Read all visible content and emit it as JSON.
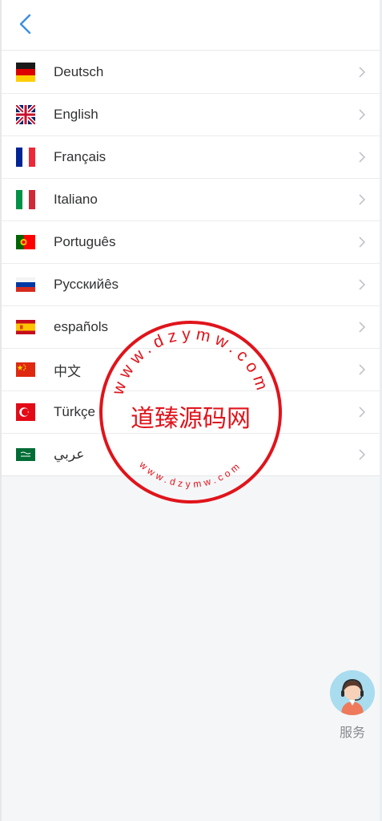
{
  "header": {
    "back_icon": "chevron-left-icon"
  },
  "languages": [
    {
      "label": "Deutsch",
      "flag": "flag-germany-icon"
    },
    {
      "label": "English",
      "flag": "flag-uk-icon"
    },
    {
      "label": "Français",
      "flag": "flag-france-icon"
    },
    {
      "label": "Italiano",
      "flag": "flag-italy-icon"
    },
    {
      "label": "Português",
      "flag": "flag-portugal-icon"
    },
    {
      "label": "Pусскийês",
      "flag": "flag-russia-icon"
    },
    {
      "label": "españols",
      "flag": "flag-spain-icon"
    },
    {
      "label": "中文",
      "flag": "flag-china-icon"
    },
    {
      "label": "Türkçe",
      "flag": "flag-turkey-icon"
    },
    {
      "label": "عربي",
      "flag": "flag-saudi-icon"
    }
  ],
  "watermark": {
    "center_text": "道臻源码网",
    "top_arc": "www.dzymw.com",
    "bottom_arc": "www.dzymw.com",
    "color": "#e0141b"
  },
  "service": {
    "label": "服务",
    "icon": "customer-service-avatar-icon"
  },
  "colors": {
    "accent": "#3a8ee6",
    "chevron": "#c0c4cc",
    "background": "#f5f6f8"
  }
}
